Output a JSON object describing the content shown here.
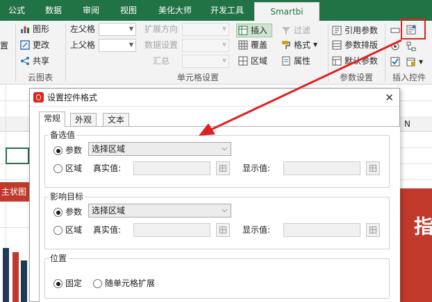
{
  "tabs": [
    "公式",
    "数据",
    "审阅",
    "视图",
    "美化大师",
    "开发工具",
    "Smartbi"
  ],
  "ribbon": {
    "clip_left": "置",
    "chart_group": {
      "items": [
        "图形",
        "更改",
        "共享"
      ],
      "label": "云图表"
    },
    "cell_group": {
      "left_parent": "左父格",
      "top_parent": "上父格",
      "expand_dir": "扩展方向",
      "data_settings": "数据设置",
      "summary": "汇总",
      "label": "单元格设置"
    },
    "insert_group": {
      "insert": "插入",
      "cover": "覆盖",
      "area": "区域"
    },
    "format_group": {
      "filter": "过滤",
      "format": "格式",
      "attr": "属性"
    },
    "param_group": {
      "items": [
        "引用参数",
        "参数排版",
        "默认参数"
      ],
      "label": "参数设置"
    },
    "control_group": {
      "label": "插入控件"
    }
  },
  "sheet": {
    "col_n": "N",
    "red_tag": "主状图",
    "red_band_text": "指"
  },
  "dialog": {
    "title": "设置控件格式",
    "close": "✕",
    "tabs": [
      "常规",
      "外观",
      "文本"
    ],
    "candidate": {
      "title": "备选值",
      "radio_param": "参数",
      "radio_area": "区域",
      "select_value": "选择区域",
      "real_value": "真实值:",
      "display_value": "显示值:"
    },
    "target": {
      "title": "影响目标",
      "radio_param": "参数",
      "radio_area": "区域",
      "select_value": "选择区域",
      "real_value": "真实值:",
      "display_value": "显示值:"
    },
    "position": {
      "title": "位置",
      "fixed": "固定",
      "expand": "随单元格扩展"
    }
  },
  "colors": {
    "accent_green": "#217346",
    "highlight_red": "#e02020",
    "brand_red": "#c0392b"
  }
}
